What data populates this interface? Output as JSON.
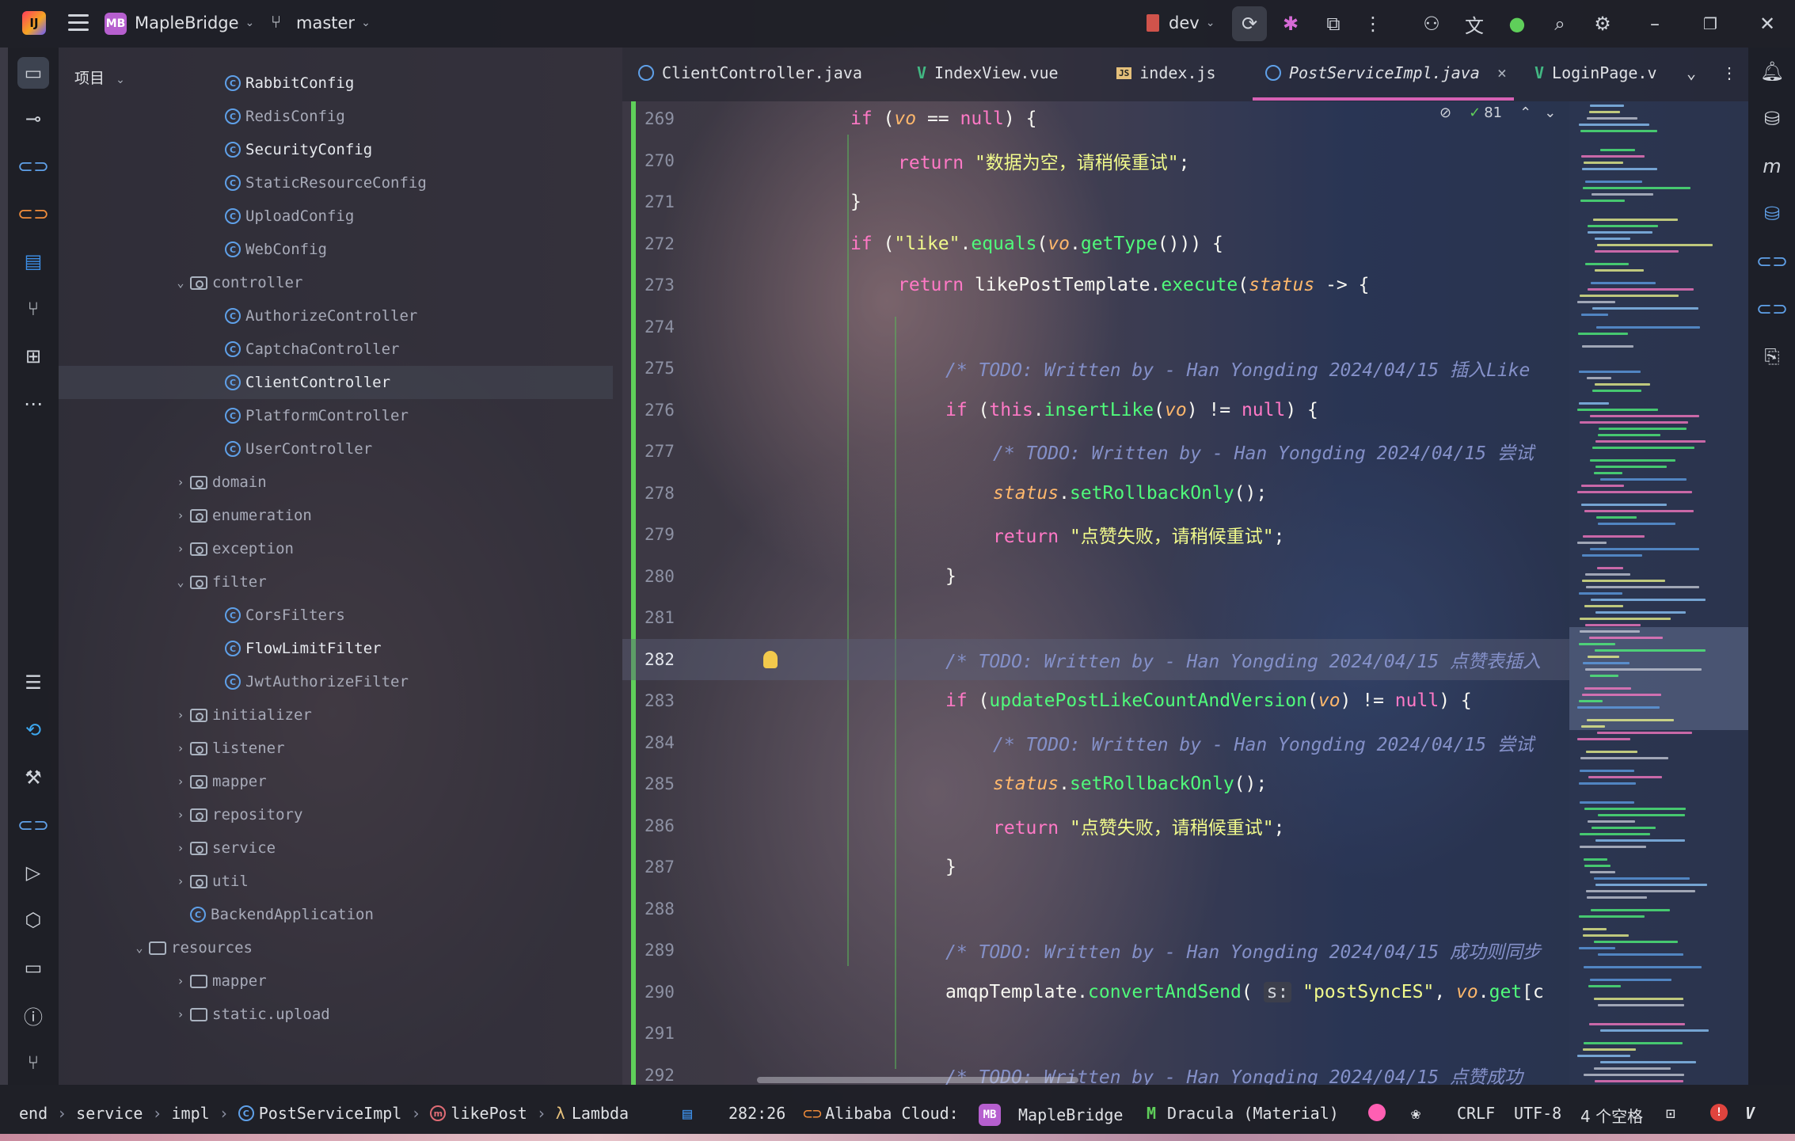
{
  "titlebar": {
    "project_badge": "MB",
    "project_name": "MapleBridge",
    "branch": "master",
    "run_config": "dev"
  },
  "project_panel": {
    "title": "项目",
    "tree": [
      {
        "label": "RabbitConfig",
        "kind": "class",
        "level": 3,
        "style": "bright"
      },
      {
        "label": "RedisConfig",
        "kind": "class",
        "level": 3,
        "style": "dim"
      },
      {
        "label": "SecurityConfig",
        "kind": "class",
        "level": 3,
        "style": "bright"
      },
      {
        "label": "StaticResourceConfig",
        "kind": "class",
        "level": 3,
        "style": "dim"
      },
      {
        "label": "UploadConfig",
        "kind": "class",
        "level": 3,
        "style": "dim"
      },
      {
        "label": "WebConfig",
        "kind": "class",
        "level": 3,
        "style": "dim"
      },
      {
        "label": "controller",
        "kind": "package",
        "level": 2,
        "expanded": true,
        "style": "dim"
      },
      {
        "label": "AuthorizeController",
        "kind": "class",
        "level": 3,
        "style": "dim"
      },
      {
        "label": "CaptchaController",
        "kind": "class",
        "level": 3,
        "style": "dim"
      },
      {
        "label": "ClientController",
        "kind": "class",
        "level": 3,
        "style": "bright",
        "selected": true
      },
      {
        "label": "PlatformController",
        "kind": "class",
        "level": 3,
        "style": "dim"
      },
      {
        "label": "UserController",
        "kind": "class",
        "level": 3,
        "style": "dim"
      },
      {
        "label": "domain",
        "kind": "package",
        "level": 2,
        "expanded": false,
        "style": "dim"
      },
      {
        "label": "enumeration",
        "kind": "package",
        "level": 2,
        "expanded": false,
        "style": "dim"
      },
      {
        "label": "exception",
        "kind": "package",
        "level": 2,
        "expanded": false,
        "style": "dim"
      },
      {
        "label": "filter",
        "kind": "package",
        "level": 2,
        "expanded": true,
        "style": "dim"
      },
      {
        "label": "CorsFilters",
        "kind": "class",
        "level": 3,
        "style": "dim"
      },
      {
        "label": "FlowLimitFilter",
        "kind": "class",
        "level": 3,
        "style": "bright"
      },
      {
        "label": "JwtAuthorizeFilter",
        "kind": "class",
        "level": 3,
        "style": "dim"
      },
      {
        "label": "initializer",
        "kind": "package",
        "level": 2,
        "expanded": false,
        "style": "dim"
      },
      {
        "label": "listener",
        "kind": "package",
        "level": 2,
        "expanded": false,
        "style": "dim"
      },
      {
        "label": "mapper",
        "kind": "package",
        "level": 2,
        "expanded": false,
        "style": "dim"
      },
      {
        "label": "repository",
        "kind": "package",
        "level": 2,
        "expanded": false,
        "style": "dim"
      },
      {
        "label": "service",
        "kind": "package",
        "level": 2,
        "expanded": false,
        "style": "dim"
      },
      {
        "label": "util",
        "kind": "package",
        "level": 2,
        "expanded": false,
        "style": "dim"
      },
      {
        "label": "BackendApplication",
        "kind": "class",
        "level": 2,
        "style": "dim"
      },
      {
        "label": "resources",
        "kind": "folder",
        "level": 1,
        "expanded": true,
        "style": "dim"
      },
      {
        "label": "mapper",
        "kind": "folder",
        "level": 2,
        "expanded": false,
        "style": "dim"
      },
      {
        "label": "static.upload",
        "kind": "folder",
        "level": 2,
        "expanded": false,
        "style": "dim"
      }
    ]
  },
  "tabs": [
    {
      "label": "ClientController.java",
      "icon": "java-class-icon",
      "active": false
    },
    {
      "label": "IndexView.vue",
      "icon": "vue-icon",
      "active": false
    },
    {
      "label": "index.js",
      "icon": "js-icon",
      "active": false
    },
    {
      "label": "PostServiceImpl.java",
      "icon": "java-class-icon",
      "active": true
    },
    {
      "label": "LoginPage.v",
      "icon": "vue-icon",
      "active": false
    }
  ],
  "editor": {
    "inspection_count": "81",
    "current_line": 282,
    "lines": [
      {
        "num": "269",
        "indent": 0,
        "tokens": [
          [
            "kw",
            "if "
          ],
          [
            "plain",
            "("
          ],
          [
            "var",
            "vo"
          ],
          [
            "plain",
            " == "
          ],
          [
            "kw",
            "null"
          ],
          [
            "plain",
            ") {"
          ]
        ]
      },
      {
        "num": "270",
        "indent": 1,
        "tokens": [
          [
            "kw",
            "return "
          ],
          [
            "str",
            "\"数据为空，请稍候重试\""
          ],
          [
            "plain",
            ";"
          ]
        ]
      },
      {
        "num": "271",
        "indent": 0,
        "tokens": [
          [
            "plain",
            "}"
          ]
        ]
      },
      {
        "num": "272",
        "indent": 0,
        "tokens": [
          [
            "kw",
            "if "
          ],
          [
            "plain",
            "("
          ],
          [
            "str",
            "\"like\""
          ],
          [
            "plain",
            "."
          ],
          [
            "fn",
            "equals"
          ],
          [
            "plain",
            "("
          ],
          [
            "var",
            "vo"
          ],
          [
            "plain",
            "."
          ],
          [
            "fn",
            "getType"
          ],
          [
            "plain",
            "())) {"
          ]
        ]
      },
      {
        "num": "273",
        "indent": 1,
        "tokens": [
          [
            "kw",
            "return "
          ],
          [
            "plain",
            "likePostTemplate."
          ],
          [
            "fn",
            "execute"
          ],
          [
            "plain",
            "("
          ],
          [
            "var",
            "status"
          ],
          [
            "plain",
            " -> {"
          ]
        ]
      },
      {
        "num": "274",
        "indent": 0,
        "tokens": []
      },
      {
        "num": "275",
        "indent": 2,
        "tokens": [
          [
            "cm",
            "/* TODO: Written by - Han Yongding 2024/04/15 插入Like"
          ]
        ]
      },
      {
        "num": "276",
        "indent": 2,
        "tokens": [
          [
            "kw",
            "if "
          ],
          [
            "plain",
            "("
          ],
          [
            "kw",
            "this"
          ],
          [
            "plain",
            "."
          ],
          [
            "fn",
            "insertLike"
          ],
          [
            "plain",
            "("
          ],
          [
            "var",
            "vo"
          ],
          [
            "plain",
            ") != "
          ],
          [
            "kw",
            "null"
          ],
          [
            "plain",
            ") {"
          ]
        ]
      },
      {
        "num": "277",
        "indent": 3,
        "tokens": [
          [
            "cm",
            "/* TODO: Written by - Han Yongding 2024/04/15 尝试"
          ]
        ]
      },
      {
        "num": "278",
        "indent": 3,
        "tokens": [
          [
            "var",
            "status"
          ],
          [
            "plain",
            "."
          ],
          [
            "fn",
            "setRollbackOnly"
          ],
          [
            "plain",
            "();"
          ]
        ]
      },
      {
        "num": "279",
        "indent": 3,
        "tokens": [
          [
            "kw",
            "return "
          ],
          [
            "str",
            "\"点赞失败，请稍候重试\""
          ],
          [
            "plain",
            ";"
          ]
        ]
      },
      {
        "num": "280",
        "indent": 2,
        "tokens": [
          [
            "plain",
            "}"
          ]
        ]
      },
      {
        "num": "281",
        "indent": 0,
        "tokens": []
      },
      {
        "num": "282",
        "indent": 2,
        "tokens": [
          [
            "cm",
            "/* TODO: Written by - Han Yongding 2024/04/15 点赞表插入"
          ]
        ]
      },
      {
        "num": "283",
        "indent": 2,
        "tokens": [
          [
            "kw",
            "if "
          ],
          [
            "plain",
            "("
          ],
          [
            "fn",
            "updatePostLikeCountAndVersion"
          ],
          [
            "plain",
            "("
          ],
          [
            "var",
            "vo"
          ],
          [
            "plain",
            ") != "
          ],
          [
            "kw",
            "null"
          ],
          [
            "plain",
            ") {"
          ]
        ]
      },
      {
        "num": "284",
        "indent": 3,
        "tokens": [
          [
            "cm",
            "/* TODO: Written by - Han Yongding 2024/04/15 尝试"
          ]
        ]
      },
      {
        "num": "285",
        "indent": 3,
        "tokens": [
          [
            "var",
            "status"
          ],
          [
            "plain",
            "."
          ],
          [
            "fn",
            "setRollbackOnly"
          ],
          [
            "plain",
            "();"
          ]
        ]
      },
      {
        "num": "286",
        "indent": 3,
        "tokens": [
          [
            "kw",
            "return "
          ],
          [
            "str",
            "\"点赞失败，请稍候重试\""
          ],
          [
            "plain",
            ";"
          ]
        ]
      },
      {
        "num": "287",
        "indent": 2,
        "tokens": [
          [
            "plain",
            "}"
          ]
        ]
      },
      {
        "num": "288",
        "indent": 0,
        "tokens": []
      },
      {
        "num": "289",
        "indent": 2,
        "tokens": [
          [
            "cm",
            "/* TODO: Written by - Han Yongding 2024/04/15 成功则同步"
          ]
        ]
      },
      {
        "num": "290",
        "indent": 2,
        "tokens": [
          [
            "plain",
            "amqpTemplate."
          ],
          [
            "fn",
            "convertAndSend"
          ],
          [
            "plain",
            "( "
          ],
          [
            "hint",
            "s:"
          ],
          [
            "plain",
            " "
          ],
          [
            "str",
            "\"postSyncES\""
          ],
          [
            "plain",
            ", "
          ],
          [
            "var",
            "vo"
          ],
          [
            "plain",
            "."
          ],
          [
            "fn",
            "get"
          ],
          [
            "plain",
            "[c"
          ]
        ]
      },
      {
        "num": "291",
        "indent": 0,
        "tokens": []
      },
      {
        "num": "292",
        "indent": 2,
        "tokens": [
          [
            "cm",
            "/* TODO: Written by - Han Yongding 2024/04/15 点赞成功"
          ]
        ]
      }
    ]
  },
  "statusbar": {
    "breadcrumb": [
      "end",
      "service",
      "impl",
      "PostServiceImpl",
      "likePost",
      "Lambda"
    ],
    "position": "282:26",
    "cloud": "Alibaba Cloud:",
    "project_badge": "MB",
    "project": "MapleBridge",
    "theme": "Dracula (Material)",
    "line_sep": "CRLF",
    "encoding": "UTF-8",
    "indent": "4 个空格"
  }
}
